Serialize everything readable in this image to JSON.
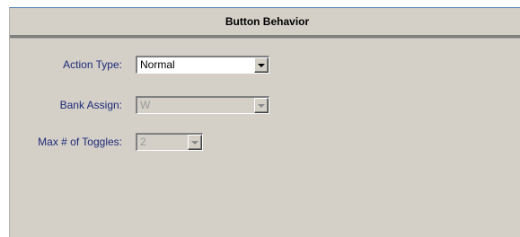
{
  "panel": {
    "title": "Button Behavior"
  },
  "form": {
    "action_type": {
      "label": "Action Type:",
      "value": "Normal",
      "enabled": true
    },
    "bank_assign": {
      "label": "Bank Assign:",
      "value": "W",
      "enabled": false
    },
    "max_toggles": {
      "label": "Max # of Toggles:",
      "value": "2",
      "enabled": false
    }
  },
  "icons": {
    "dropdown": "chevron-down-icon"
  }
}
